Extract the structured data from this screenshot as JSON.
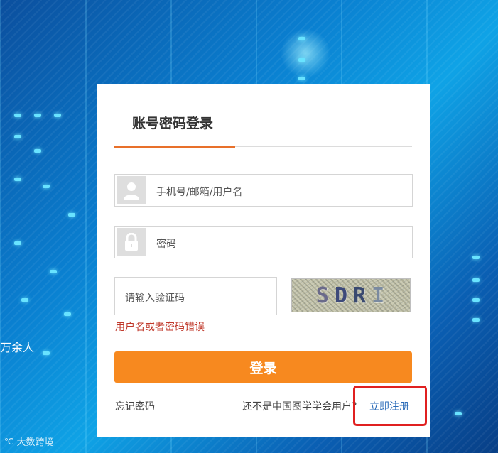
{
  "login": {
    "title": "账号密码登录",
    "username_placeholder": "手机号/邮箱/用户名",
    "password_placeholder": "密码",
    "captcha_placeholder": "请输入验证码",
    "captcha_text": [
      "S",
      "D",
      "R",
      "I"
    ],
    "error_message": "用户名或者密码错误",
    "submit_label": "登录",
    "forgot_password": "忘记密码",
    "not_member_prompt": "还不是中国图学学会用户？",
    "register_link": "立即注册"
  },
  "background": {
    "side_text": "万余人",
    "watermark": "大数跨境"
  },
  "colors": {
    "accent": "#f7891f",
    "tab_underline": "#e8702a",
    "error": "#c0392b",
    "link": "#2a6bb8",
    "highlight": "#e02020"
  }
}
